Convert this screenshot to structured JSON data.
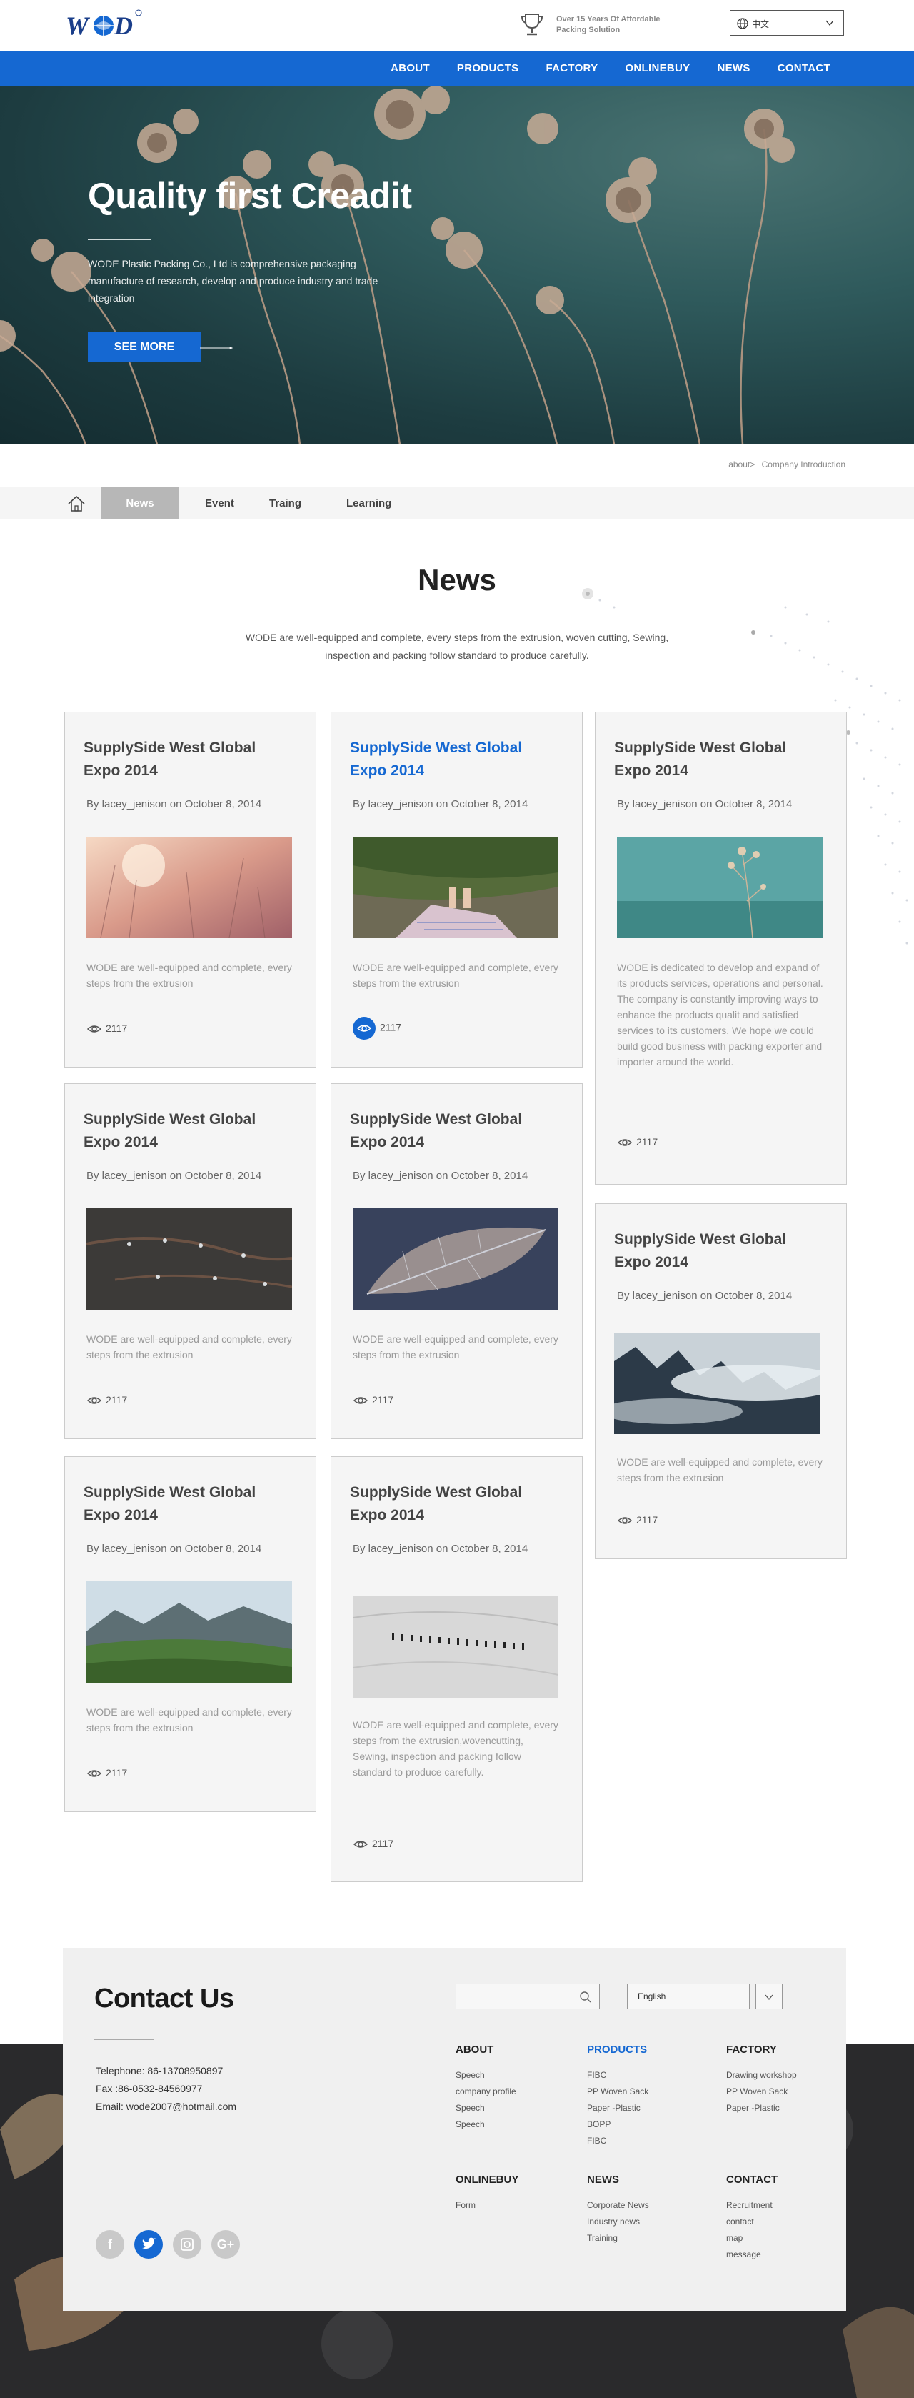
{
  "header": {
    "logo_text": "WOD",
    "tagline_line1": "Over 15 Years Of Affordable",
    "tagline_line2": "Packing Solution",
    "language_label": "中文"
  },
  "nav": {
    "items": [
      "ABOUT",
      "PRODUCTS",
      "FACTORY",
      "ONLINEBUY",
      "NEWS",
      "CONTACT"
    ]
  },
  "hero": {
    "title": "Quality first Creadit",
    "description": "WODE Plastic Packing Co., Ltd is comprehensive packaging manufacture of research, develop and produce industry and trade integration",
    "button_label": "SEE MORE"
  },
  "breadcrumb": {
    "parent": "about>",
    "current": "Company Introduction"
  },
  "subnav": {
    "tabs": [
      "News",
      "Event",
      "Traing",
      "Learning"
    ],
    "active": "News"
  },
  "news": {
    "title": "News",
    "subtitle": "WODE are well-equipped and complete, every steps from the extrusion, woven cutting, Sewing, inspection and packing follow standard to produce carefully."
  },
  "cards": [
    {
      "title": "SupplySide West Global Expo 2014",
      "byline": "By lacey_jenison on October 8, 2014",
      "text": "WODE are well-equipped and complete, every steps from the extrusion",
      "views": "2117",
      "image": "sunset-grass"
    },
    {
      "title": "SupplySide West Global Expo 2014",
      "byline": "By lacey_jenison on October 8, 2014",
      "text": "WODE are well-equipped and complete, every steps from the extrusion",
      "views": "2117",
      "image": "cliff-feet"
    },
    {
      "title": "SupplySide West Global Expo 2014",
      "byline": "By lacey_jenison on October 8, 2014",
      "text": "WODE is dedicated to develop and expand of its products services, operations and personal. The company is constantly improving ways to enhance the products qualit and satisfied services  to its customers. We hope we could build good business with packing exporter and importer around the world.",
      "views": "2117",
      "image": "teal-plant"
    },
    {
      "title": "SupplySide West Global Expo 2014",
      "byline": "By lacey_jenison on October 8, 2014",
      "text": "WODE are well-equipped and complete, every steps from the extrusion",
      "views": "2117",
      "image": "rain-branch"
    },
    {
      "title": "SupplySide West Global Expo 2014",
      "byline": "By lacey_jenison on October 8, 2014",
      "text": "WODE are well-equipped and complete, every steps from the extrusion",
      "views": "2117",
      "image": "frost-leaf"
    },
    {
      "title": "SupplySide West Global Expo 2014",
      "byline": "By lacey_jenison on October 8, 2014",
      "text": "WODE are well-equipped and complete, every steps from the extrusion",
      "views": "2117",
      "image": "misty-forest"
    },
    {
      "title": "SupplySide West Global Expo 2014",
      "byline": "By lacey_jenison on October 8, 2014",
      "text": "WODE are well-equipped and complete, every steps from the extrusion",
      "views": "2117",
      "image": "green-valley"
    },
    {
      "title": "SupplySide West Global Expo 2014",
      "byline": "By lacey_jenison on October 8, 2014",
      "text": "WODE are well-equipped and complete, every steps from the extrusion,wovencutting, Sewing, inspection and packing follow standard to produce carefully.",
      "views": "2117",
      "image": "snow-hikers"
    }
  ],
  "footer": {
    "contact_title": "Contact Us",
    "telephone": "Telephone: 86-13708950897",
    "fax": "Fax :86-0532-84560977",
    "email": "Email: wode2007@hotmail.com",
    "language_select": "English",
    "social": [
      "f",
      "twitter-icon",
      "instagram-icon",
      "G+"
    ],
    "columns": {
      "about": {
        "title": "ABOUT",
        "links": [
          "Speech",
          "company profile",
          "Speech",
          "Speech"
        ]
      },
      "products": {
        "title": "PRODUCTS",
        "links": [
          "FIBC",
          "PP Woven Sack",
          "Paper -Plastic",
          "BOPP",
          "FIBC"
        ]
      },
      "factory": {
        "title": "FACTORY",
        "links": [
          "Drawing workshop",
          "PP Woven Sack",
          "Paper -Plastic"
        ]
      },
      "onlinebuy": {
        "title": "ONLINEBUY",
        "links": [
          "Form"
        ]
      },
      "news": {
        "title": "NEWS",
        "links": [
          "Corporate News",
          "Industry news",
          "Training"
        ]
      },
      "contact": {
        "title": "CONTACT",
        "links": [
          "Recruitment",
          "contact",
          "map",
          "message"
        ]
      }
    }
  },
  "colors": {
    "brand_blue": "#1568d2",
    "card_bg": "#f5f5f5"
  }
}
